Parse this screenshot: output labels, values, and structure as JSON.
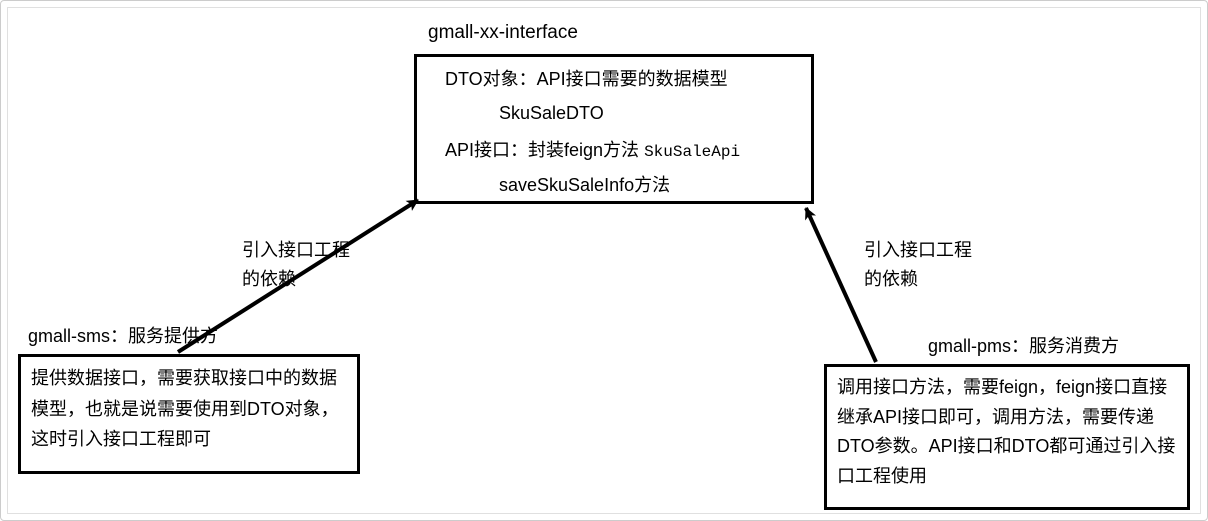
{
  "top": {
    "title": "gmall-xx-interface",
    "line1a": "DTO对象：API接口需要的数据模型",
    "line1b": "SkuSaleDTO",
    "line2a": "API接口：封装feign方法",
    "line2a_mono": "SkuSaleApi",
    "line2b": "saveSkuSaleInfo方法"
  },
  "left": {
    "title": "gmall-sms：服务提供方",
    "body": "提供数据接口，需要获取接口中的数据模型，也就是说需要使用到DTO对象，这时引入接口工程即可"
  },
  "right": {
    "title": "gmall-pms：服务消费方",
    "body": "调用接口方法，需要feign，feign接口直接继承API接口即可，调用方法，需要传递DTO参数。API接口和DTO都可通过引入接口工程使用"
  },
  "arrow_left_label": "引入接口工程\n的依赖",
  "arrow_right_label": "引入接口工程\n的依赖"
}
